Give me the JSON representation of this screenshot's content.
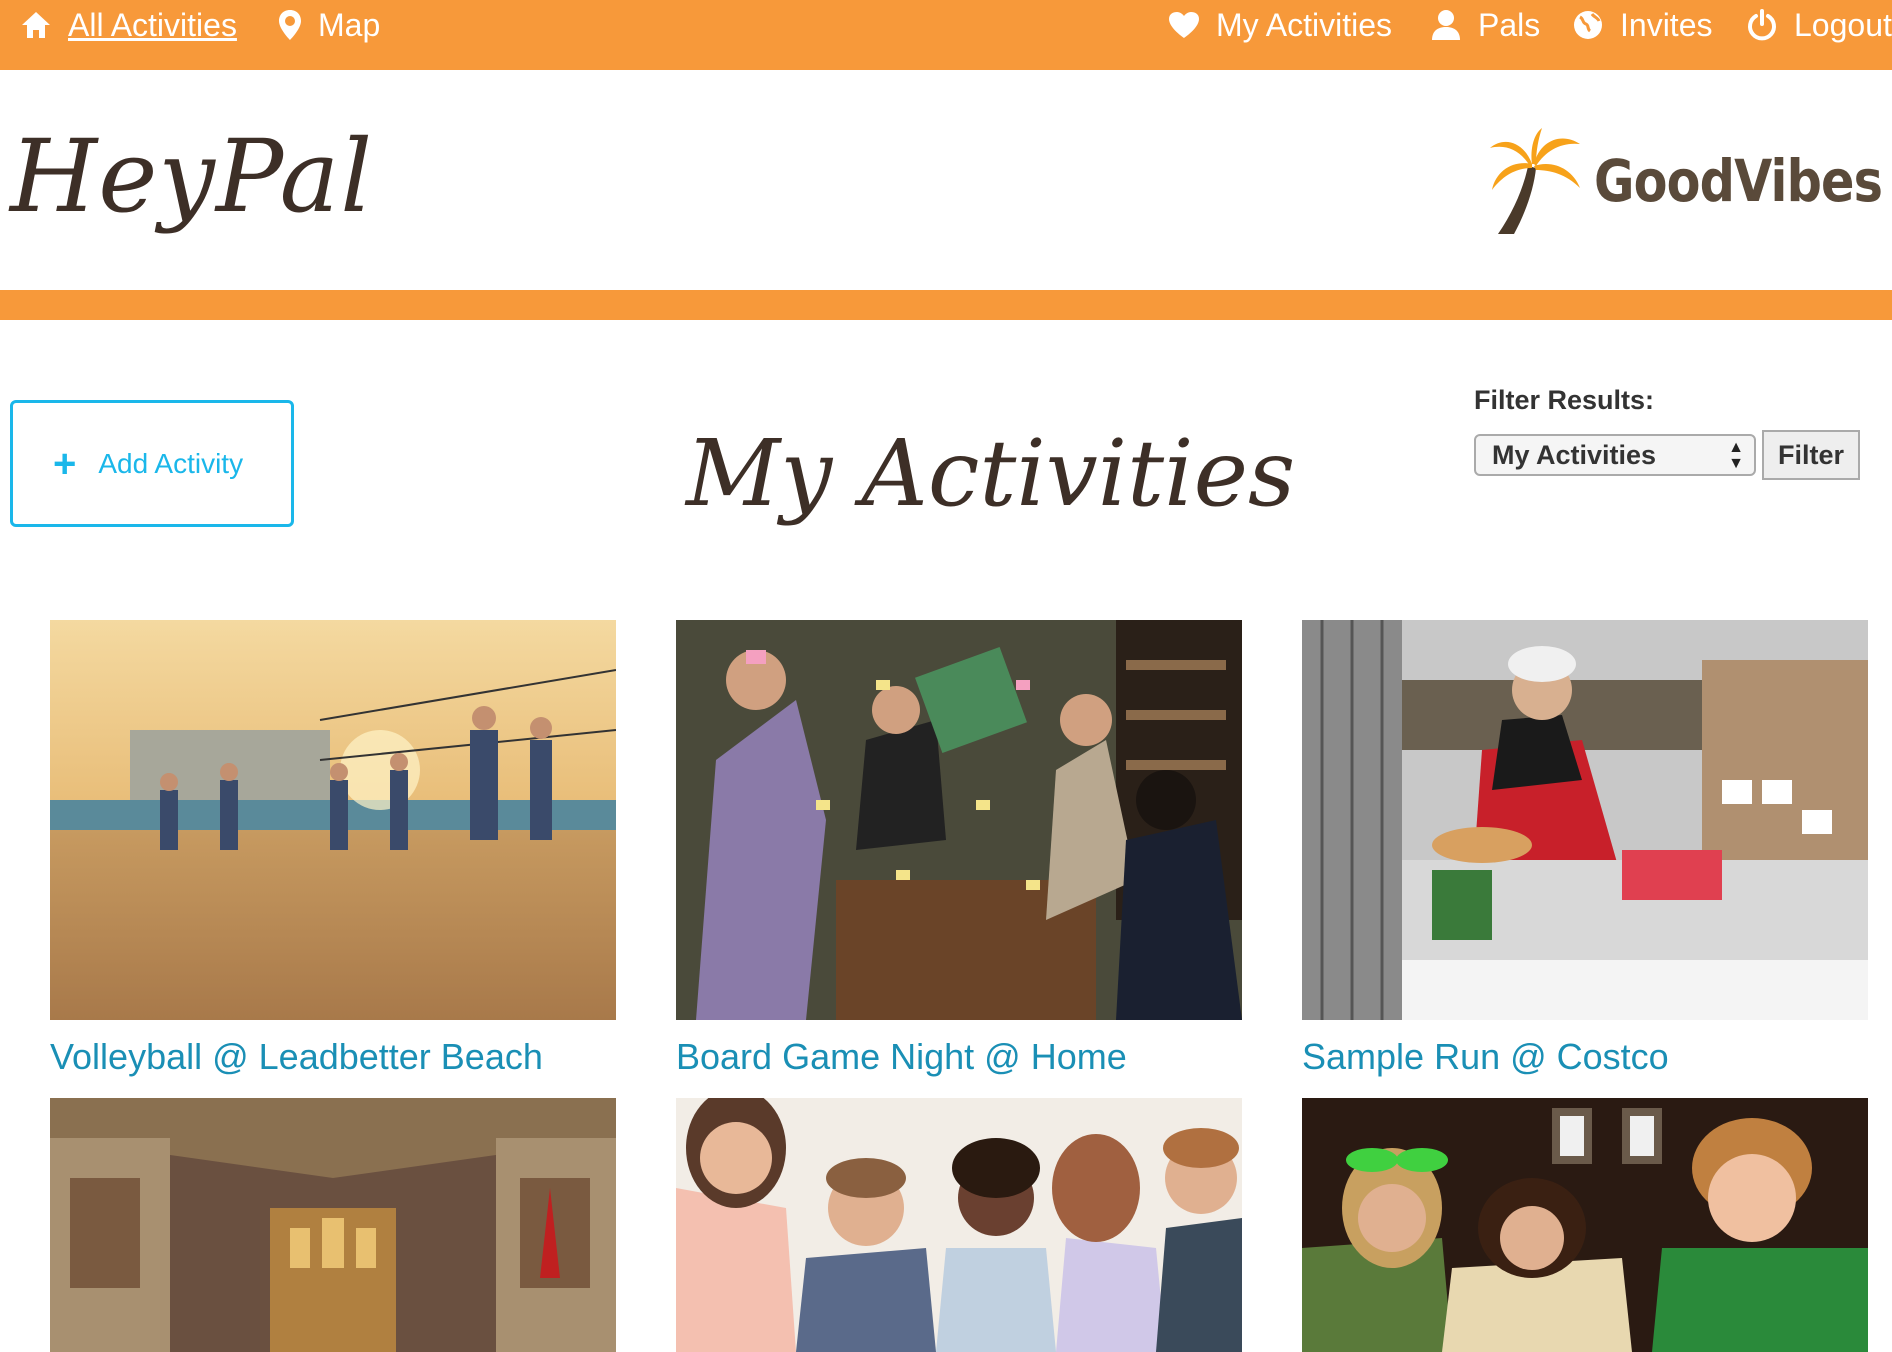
{
  "nav": {
    "all_activities": "All Activities",
    "map": "Map",
    "my_activities": "My Activities",
    "pals": "Pals",
    "invites": "Invites",
    "logout": "Logout"
  },
  "header": {
    "logo": "HeyPal",
    "brand": "GoodVibes"
  },
  "controls": {
    "add_activity": "Add Activity",
    "page_title": "My Activities",
    "filter_label": "Filter Results:",
    "filter_selected": "My Activities",
    "filter_button": "Filter"
  },
  "activities": [
    {
      "title": "Volleyball @ Leadbetter Beach"
    },
    {
      "title": "Board Game Night @ Home"
    },
    {
      "title": "Sample Run @ Costco"
    },
    {
      "title": ""
    },
    {
      "title": ""
    },
    {
      "title": ""
    }
  ],
  "colors": {
    "accent": "#f7993a",
    "link": "#1a8fb5",
    "button_border": "#1ab7ea",
    "heading": "#3d2f27"
  }
}
